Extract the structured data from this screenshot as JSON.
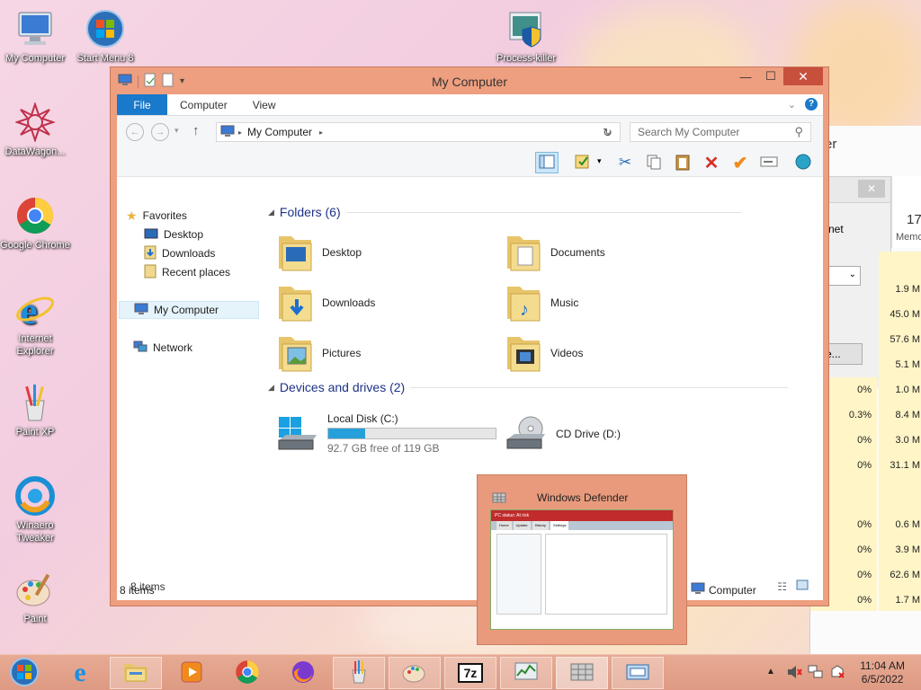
{
  "desktop": {
    "icons": [
      {
        "label": "My Computer",
        "icon": "computer-icon"
      },
      {
        "label": "Start Menu 8",
        "icon": "start-menu-icon"
      },
      {
        "label": "Process-killer",
        "icon": "shield-icon"
      },
      {
        "label": "DataWagon...",
        "icon": "datawagon-icon"
      },
      {
        "label": "Google Chrome",
        "icon": "chrome-icon"
      },
      {
        "label": "Internet Explorer",
        "icon": "ie-icon"
      },
      {
        "label": "Paint XP",
        "icon": "paint-xp-icon"
      },
      {
        "label": "Winaero Tweaker",
        "icon": "winaero-icon"
      },
      {
        "label": "Paint",
        "icon": "paint-icon"
      }
    ]
  },
  "background_window": {
    "partial_title": "er",
    "partial_label": "rnet",
    "partial_button": "e...",
    "column_count": "17",
    "column_label": "Memo",
    "cpu_values": [
      "0%",
      "0.3%",
      "0%",
      "0%",
      "0%",
      "0%",
      "0%",
      "0%"
    ],
    "mem_values": [
      "1.9 M",
      "45.0 M",
      "57.6 M",
      "5.1 M",
      "1.0 M",
      "8.4 M",
      "3.0 M",
      "31.1 M",
      "0.6 M",
      "3.9 M",
      "62.6 M",
      "1.7 M"
    ]
  },
  "explorer": {
    "title": "My Computer",
    "tabs": {
      "file": "File",
      "computer": "Computer",
      "view": "View"
    },
    "address": "My Computer",
    "search_placeholder": "Search My Computer",
    "nav": {
      "favorites": "Favorites",
      "desktop": "Desktop",
      "downloads": "Downloads",
      "recent": "Recent places",
      "computer": "My Computer",
      "network": "Network"
    },
    "folders_header": "Folders (6)",
    "folders": [
      "Desktop",
      "Documents",
      "Downloads",
      "Music",
      "Pictures",
      "Videos"
    ],
    "drives_header": "Devices and drives (2)",
    "drives": [
      {
        "name": "Local Disk (C:)",
        "free": "92.7 GB free of 119 GB",
        "used_fraction": 0.22
      },
      {
        "name": "CD Drive (D:)"
      }
    ],
    "status_items": "8 items",
    "status_items2": "8 items",
    "status_location": "Computer"
  },
  "thumbnail": {
    "title": "Windows Defender",
    "inner_title": "PC status: At risk",
    "inner_tabs": [
      "Home",
      "Update",
      "History",
      "Settings"
    ]
  },
  "taskbar": {
    "time": "11:04 AM",
    "date": "6/5/2022"
  },
  "colors": {
    "accent": "#1979ca",
    "titlebar": "#ee9f7f",
    "close": "#c7503c",
    "drive_bar": "#26a0da"
  }
}
